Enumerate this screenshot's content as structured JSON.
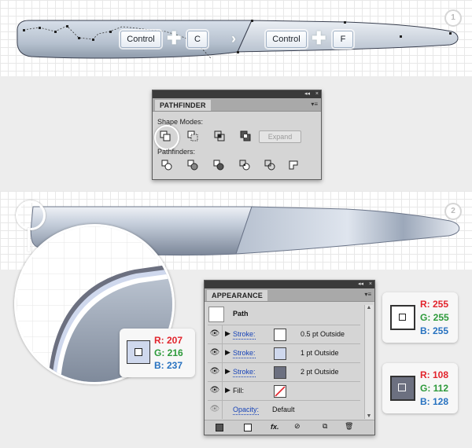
{
  "step1": {
    "badge": "1",
    "keys": {
      "control_1": "Control",
      "c": "C",
      "control_2": "Control",
      "f": "F"
    }
  },
  "pathfinder": {
    "tab_label": "PATHFINDER",
    "shape_modes_label": "Shape Modes:",
    "pathfinders_label": "Pathfinders:",
    "expand_label": "Expand",
    "collapse_glyph": "◂◂",
    "close_glyph": "×",
    "menu_glyph": "▾≡"
  },
  "step2": {
    "badge": "2"
  },
  "appearance": {
    "tab_label": "APPEARANCE",
    "collapse_glyph": "◂◂",
    "close_glyph": "×",
    "menu_glyph": "▾≡",
    "header": "Path",
    "rows": [
      {
        "label": "Stroke:",
        "value": "0.5 pt  Outside",
        "swatch": "#ffffff"
      },
      {
        "label": "Stroke:",
        "value": "1 pt  Outside",
        "swatch": "#cfd8ed"
      },
      {
        "label": "Stroke:",
        "value": "2 pt  Outside",
        "swatch": "#6c7080"
      }
    ],
    "fill_label": "Fill:",
    "opacity_label": "Opacity:",
    "opacity_value": "Default",
    "fx_glyph": "fx."
  },
  "colors": {
    "card_a": {
      "r": "R: 207",
      "g": "G: 216",
      "b": "B: 237",
      "hex": "#cfd8ed"
    },
    "card_b": {
      "r": "R: 255",
      "g": "G: 255",
      "b": "B: 255",
      "hex": "#ffffff"
    },
    "card_c": {
      "r": "R: 108",
      "g": "G: 112",
      "b": "B: 128",
      "hex": "#6c7080"
    }
  }
}
